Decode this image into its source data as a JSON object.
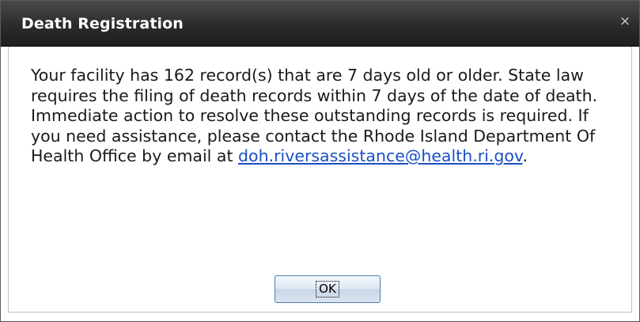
{
  "dialog": {
    "title": "Death Registration",
    "close_glyph": "×",
    "message_part1": "Your facility has 162 record(s) that are 7 days old or older. State law requires the filing of death records within 7 days of the date of death. Immediate action to resolve these outstanding records is required. If you need assistance, please contact the Rhode Island Department Of Health Office by email at ",
    "email_link": "doh.riversassistance@health.ri.gov",
    "message_part2": ".",
    "ok_label": "OK"
  },
  "colors": {
    "titlebar": "#2b2b2b",
    "link": "#1a4fc4",
    "button_border": "#4d7ab0"
  },
  "icons": {
    "close": "close-icon"
  }
}
